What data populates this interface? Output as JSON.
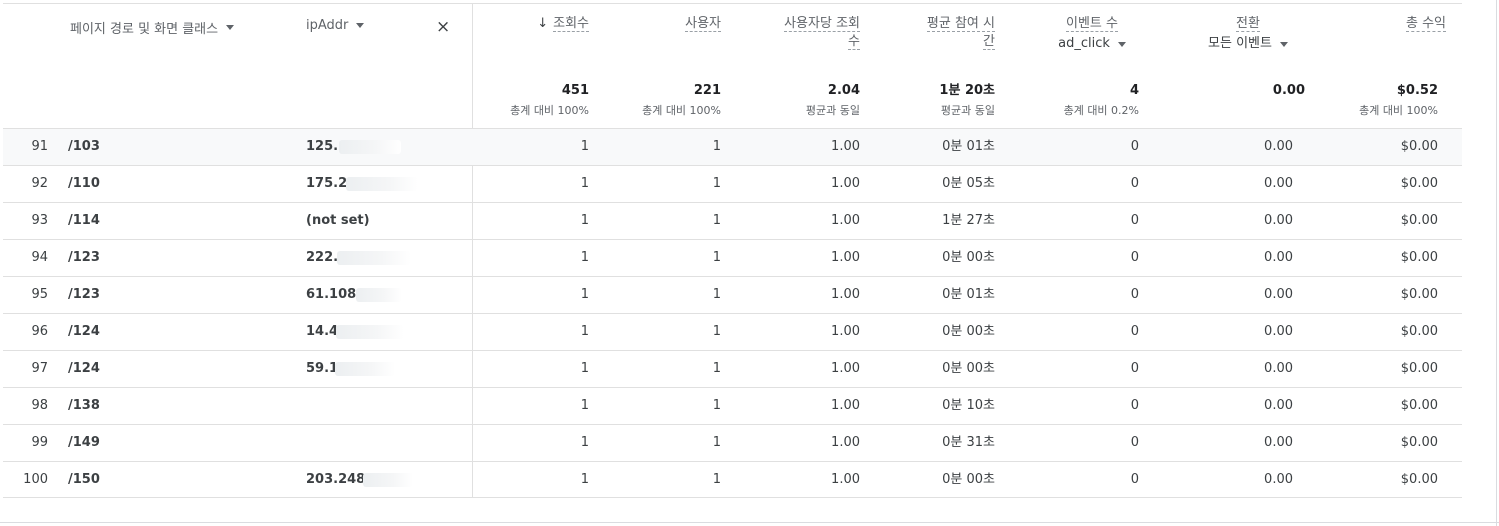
{
  "dimension_headers": {
    "page_path": "페이지 경로 및 화면 클래스",
    "ip_addr": "ipAddr",
    "remove_label": "×"
  },
  "metric_headers": {
    "views": "조회수",
    "views_sort_arrow": "↓",
    "users": "사용자",
    "views_per_user_line1": "사용자당 조회",
    "views_per_user_line2": "수",
    "avg_engagement_line1": "평균 참여 시",
    "avg_engagement_line2": "간",
    "event_count": "이벤트 수",
    "event_filter": "ad_click",
    "conversions": "전환",
    "conversions_filter": "모든 이벤트",
    "total_revenue": "총 수익"
  },
  "totals": {
    "views": "451",
    "views_sub": "총계 대비 100%",
    "users": "221",
    "users_sub": "총계 대비 100%",
    "views_per_user": "2.04",
    "views_per_user_sub": "평균과 동일",
    "avg_engagement": "1분 20초",
    "avg_engagement_sub": "평균과 동일",
    "event_count": "4",
    "event_count_sub": "총계 대비 0.2%",
    "conversions": "0.00",
    "total_revenue": "$0.52",
    "total_revenue_sub": "총계 대비 100%"
  },
  "rows": [
    {
      "n": "91",
      "page": "/103",
      "ip": "125.",
      "views": "1",
      "users": "1",
      "vpu": "1.00",
      "eng": "0분 01초",
      "events": "0",
      "conv": "0.00",
      "rev": "$0.00"
    },
    {
      "n": "92",
      "page": "/110",
      "ip": "175.2",
      "views": "1",
      "users": "1",
      "vpu": "1.00",
      "eng": "0분 05초",
      "events": "0",
      "conv": "0.00",
      "rev": "$0.00"
    },
    {
      "n": "93",
      "page": "/114",
      "ip": "(not set)",
      "views": "1",
      "users": "1",
      "vpu": "1.00",
      "eng": "1분 27초",
      "events": "0",
      "conv": "0.00",
      "rev": "$0.00"
    },
    {
      "n": "94",
      "page": "/123",
      "ip": "222.",
      "views": "1",
      "users": "1",
      "vpu": "1.00",
      "eng": "0분 00초",
      "events": "0",
      "conv": "0.00",
      "rev": "$0.00"
    },
    {
      "n": "95",
      "page": "/123",
      "ip": "61.108.",
      "views": "1",
      "users": "1",
      "vpu": "1.00",
      "eng": "0분 01초",
      "events": "0",
      "conv": "0.00",
      "rev": "$0.00"
    },
    {
      "n": "96",
      "page": "/124",
      "ip": "14.4",
      "views": "1",
      "users": "1",
      "vpu": "1.00",
      "eng": "0분 00초",
      "events": "0",
      "conv": "0.00",
      "rev": "$0.00"
    },
    {
      "n": "97",
      "page": "/124",
      "ip": "59.1",
      "views": "1",
      "users": "1",
      "vpu": "1.00",
      "eng": "0분 00초",
      "events": "0",
      "conv": "0.00",
      "rev": "$0.00"
    },
    {
      "n": "98",
      "page": "/138",
      "ip": "",
      "views": "1",
      "users": "1",
      "vpu": "1.00",
      "eng": "0분 10초",
      "events": "0",
      "conv": "0.00",
      "rev": "$0.00"
    },
    {
      "n": "99",
      "page": "/149",
      "ip": "",
      "views": "1",
      "users": "1",
      "vpu": "1.00",
      "eng": "0분 31초",
      "events": "0",
      "conv": "0.00",
      "rev": "$0.00"
    },
    {
      "n": "100",
      "page": "/150",
      "ip": "203.248",
      "views": "1",
      "users": "1",
      "vpu": "1.00",
      "eng": "0분 00초",
      "events": "0",
      "conv": "0.00",
      "rev": "$0.00"
    }
  ]
}
